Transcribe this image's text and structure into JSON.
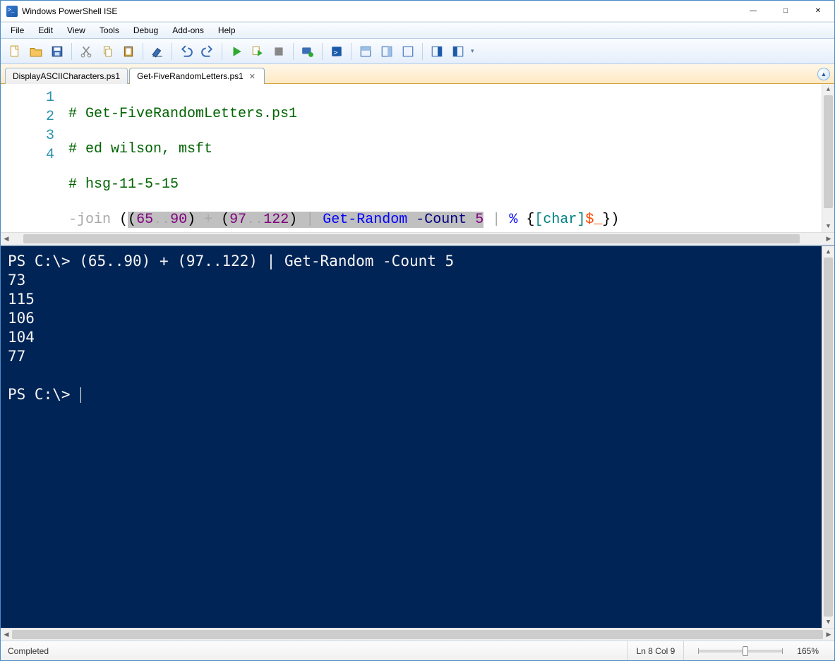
{
  "window": {
    "title": "Windows PowerShell ISE"
  },
  "menu": {
    "items": [
      "File",
      "Edit",
      "View",
      "Tools",
      "Debug",
      "Add-ons",
      "Help"
    ]
  },
  "toolbar": {
    "buttons": [
      {
        "name": "new-file-icon"
      },
      {
        "name": "open-file-icon"
      },
      {
        "name": "save-icon"
      },
      {
        "sep": true
      },
      {
        "name": "cut-icon"
      },
      {
        "name": "copy-icon"
      },
      {
        "name": "paste-icon"
      },
      {
        "sep": true
      },
      {
        "name": "clear-icon"
      },
      {
        "sep": true
      },
      {
        "name": "undo-icon"
      },
      {
        "name": "redo-icon"
      },
      {
        "sep": true
      },
      {
        "name": "run-icon"
      },
      {
        "name": "run-selection-icon"
      },
      {
        "name": "stop-icon"
      },
      {
        "sep": true
      },
      {
        "name": "breakpoint-icon"
      },
      {
        "sep": true
      },
      {
        "name": "remote-icon"
      },
      {
        "sep": true
      },
      {
        "name": "layout-script-top-icon"
      },
      {
        "name": "layout-side-icon"
      },
      {
        "name": "layout-max-icon"
      },
      {
        "sep": true
      },
      {
        "name": "show-command-icon"
      },
      {
        "name": "show-addon-icon"
      }
    ]
  },
  "tabs": {
    "items": [
      {
        "label": "DisplayASCIICharacters.ps1",
        "active": false,
        "unsaved": false
      },
      {
        "label": "Get-FiveRandomLetters.ps1",
        "active": true,
        "unsaved": false
      }
    ]
  },
  "editor": {
    "lines": [
      "1",
      "2",
      "3",
      "4"
    ],
    "content": {
      "l1": "# Get-FiveRandomLetters.ps1",
      "l2": "# ed wilson, msft",
      "l3": "# hsg-11-5-15",
      "l4": {
        "join": "-join",
        "openp1": "(",
        "sel_open": "(",
        "n65": "65",
        "dots1": "..",
        "n90": "90",
        "close1": ")",
        "plus": " + ",
        "open2": "(",
        "n97": "97",
        "dots2": "..",
        "n122": "122",
        "close2": ")",
        "pipe1": " | ",
        "getrandom": "Get-Random",
        "paramcount": " -Count ",
        "five": "5",
        "pipe2": " | ",
        "percent": "%",
        "brace_open": " {",
        "br1": "[",
        "char": "char",
        "br2": "]",
        "var": "$_",
        "brace_close": "}",
        "finalclose": ")"
      }
    }
  },
  "console": {
    "prompt": "PS C:\\>",
    "command": "(65..90) + (97..122) | Get-Random -Count 5",
    "output": [
      "73",
      "115",
      "106",
      "104",
      "77"
    ],
    "prompt2": "PS C:\\> "
  },
  "status": {
    "state": "Completed",
    "position": "Ln 8  Col 9",
    "zoom": "165%"
  }
}
